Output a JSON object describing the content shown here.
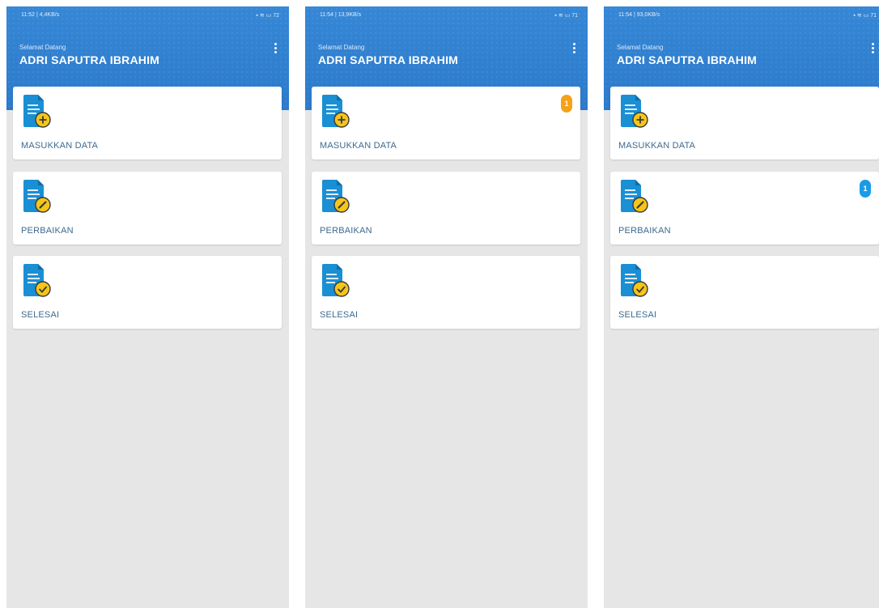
{
  "colors": {
    "header": "#2f7fcf",
    "card_label": "#3e6a8e",
    "badge_orange": "#f5a11a",
    "badge_blue": "#1a9be8",
    "background": "#e6e6e6"
  },
  "screens": [
    {
      "status": {
        "time": "11:52 | 4,4KB/s",
        "icons": "▪ ≋ ▭ 72"
      },
      "greeting": "Selamat Datang",
      "user_name": "ADRI SAPUTRA IBRAHIM",
      "menu_icon": "more-vert-icon",
      "items": [
        {
          "label": "MASUKKAN DATA",
          "icon": "document-add-icon",
          "badge": ""
        },
        {
          "label": "PERBAIKAN",
          "icon": "document-edit-icon",
          "badge": ""
        },
        {
          "label": "SELESAI",
          "icon": "document-check-icon",
          "badge": ""
        }
      ]
    },
    {
      "status": {
        "time": "11:54 | 13,9KB/s",
        "icons": "▪ ≋ ▭ 71"
      },
      "greeting": "Selamat Datang",
      "user_name": "ADRI SAPUTRA IBRAHIM",
      "menu_icon": "more-vert-icon",
      "items": [
        {
          "label": "MASUKKAN DATA",
          "icon": "document-add-icon",
          "badge": "1"
        },
        {
          "label": "PERBAIKAN",
          "icon": "document-edit-icon",
          "badge": ""
        },
        {
          "label": "SELESAI",
          "icon": "document-check-icon",
          "badge": ""
        }
      ]
    },
    {
      "status": {
        "time": "11:54 | 93,0KB/s",
        "icons": "▪ ≋ ▭ 71"
      },
      "greeting": "Selamat Datang",
      "user_name": "ADRI SAPUTRA IBRAHIM",
      "menu_icon": "more-vert-icon",
      "items": [
        {
          "label": "MASUKKAN DATA",
          "icon": "document-add-icon",
          "badge": ""
        },
        {
          "label": "PERBAIKAN",
          "icon": "document-edit-icon",
          "badge": "1"
        },
        {
          "label": "SELESAI",
          "icon": "document-check-icon",
          "badge": ""
        }
      ]
    }
  ]
}
